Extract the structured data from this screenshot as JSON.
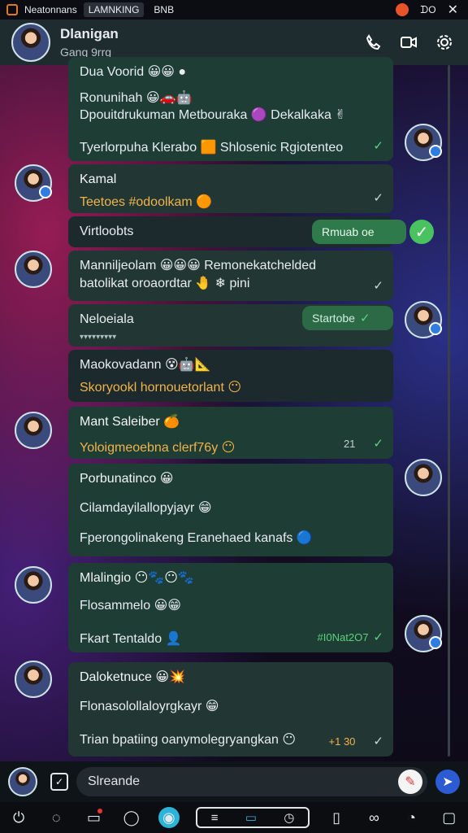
{
  "statusbar": {
    "app_name": "Neatonnans",
    "tab_active": "LAMNKING",
    "tab_other": "BNB",
    "ctrl": "ᗪO",
    "close": "✕"
  },
  "header": {
    "name": "Dlanigan",
    "subtitle": "Gang 9rrg"
  },
  "messages": [
    {
      "line1": "Dua Voorid 😀😀 ●",
      "line2": "Ronunihah 😀🚗🤖",
      "line3": "Dpouitdrukuman Metbouraka 🟣 Dekalkaka ✌",
      "line4": "Tyerlorpuha Klerabo 🟧 Shlosenic Rgiotenteo",
      "line4_highlight": "Shlosenic"
    },
    {
      "sender": "Kamal",
      "text": "Teetoes #odoolkam 🟠"
    },
    {
      "text": "Virtloobts",
      "pill": "Rmuab oe"
    },
    {
      "line1": "Manniljeolam 😀😀😀 Remonekatchelded",
      "line2": "batolikat oroaordtar 🤚 ❄ pini"
    },
    {
      "text": "Neloeiala",
      "sub": "▾▾▾▾▾▾▾▾▾",
      "pill": "Startobe"
    },
    {
      "line1": "Maokovadann 😵🤖📐",
      "line2": "Skoryookl hornouetorlant 😶"
    },
    {
      "sender": "Mant Saleiber 🍊",
      "text": "Yoloigmeoebna clerf76y 😶",
      "meta": "21"
    },
    {
      "sender": "Porbunatinco 😀",
      "line2": "Cilamdayilallopyjayr 😁",
      "line3": "Fperongolinakeng Eranehaed kanafs 🔵"
    },
    {
      "sender": "Mlalingio 😶🐾😶🐾",
      "line2": "Flosammelo 😀😁",
      "line3": "Fkart Tentaldo 👤",
      "meta": "#I0Nat2O7"
    },
    {
      "sender": "Daloketnuce 😀💥",
      "line2": "Flonasolollaloyrgkayr 😁",
      "line3": "Trian bpatiing oanymolegryangkan 😶",
      "meta": "+1 30"
    }
  ],
  "composer": {
    "placeholder": "Slreande"
  },
  "colors": {
    "bubble_out": "#1d3d35",
    "bubble_in": "#223634",
    "tick_green": "#5ad47e",
    "accent_orange": "#f1b34a"
  }
}
